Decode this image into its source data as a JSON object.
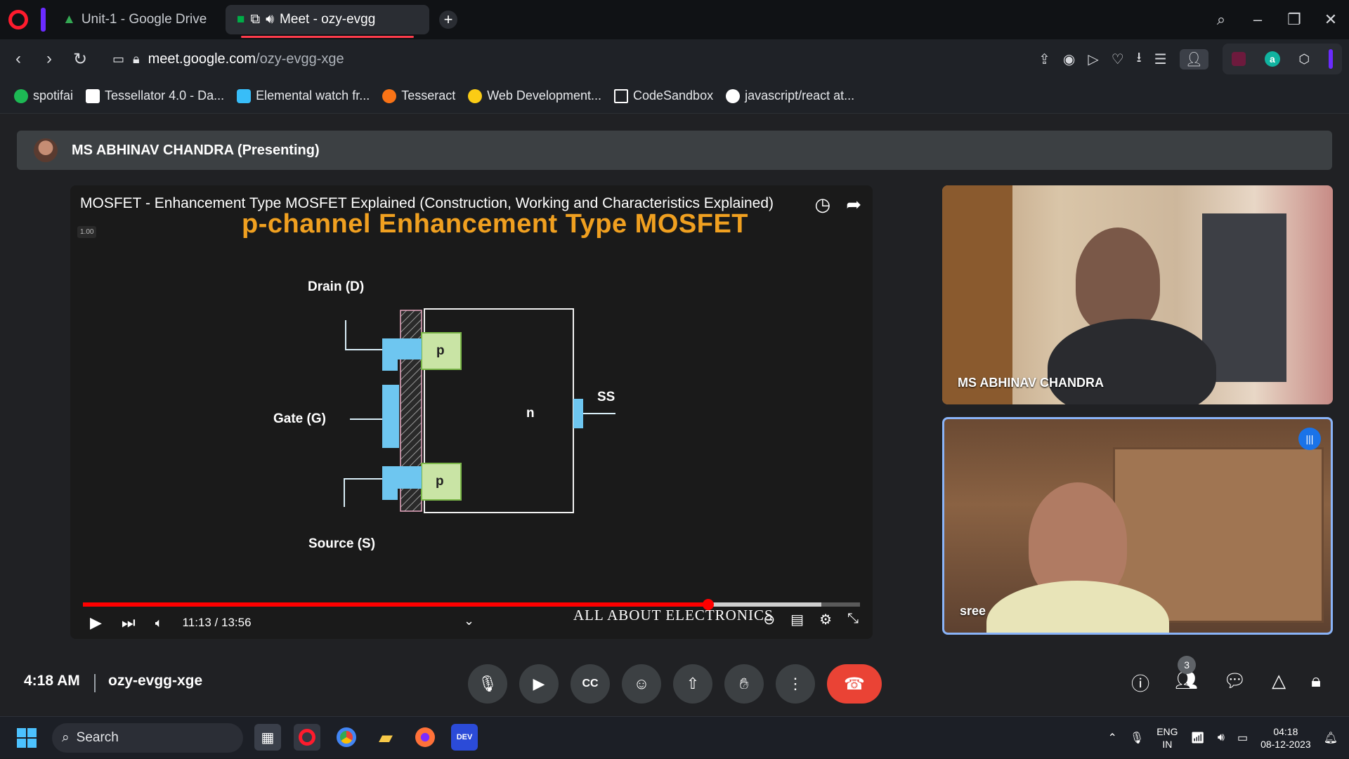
{
  "browser": {
    "tabs": [
      {
        "label": "Unit-1 - Google Drive",
        "active": false
      },
      {
        "label": "Meet - ozy-evgg",
        "active": true
      }
    ],
    "url_host": "meet.google.com",
    "url_path": "/ozy-evgg-xge",
    "bookmarks": [
      {
        "label": "spotifai",
        "color": "#1db954"
      },
      {
        "label": "Tessellator 4.0 - Da...",
        "color": "#ffffff"
      },
      {
        "label": "Elemental watch fr...",
        "color": "#38bdf8"
      },
      {
        "label": "Tesseract",
        "color": "#f97316"
      },
      {
        "label": "Web Development...",
        "color": "#facc15"
      },
      {
        "label": "CodeSandbox",
        "color": "#ffffff"
      },
      {
        "label": "javascript/react at...",
        "color": "#ffffff"
      }
    ]
  },
  "meet": {
    "presenter_label": "MS ABHINAV CHANDRA (Presenting)",
    "meeting_time": "4:18 AM",
    "meeting_code": "ozy-evgg-xge",
    "participant_count": "3",
    "tiles": [
      {
        "name": "MS ABHINAV CHANDRA",
        "speaking": false
      },
      {
        "name": "sree",
        "speaking": true
      }
    ]
  },
  "video": {
    "title": "MOSFET - Enhancement Type MOSFET Explained (Construction, Working and Characteristics Explained)",
    "speed_badge": "1.00",
    "heading": "p-channel Enhancement Type MOSFET",
    "labels": {
      "drain": "Drain (D)",
      "gate": "Gate (G)",
      "source": "Source (S)",
      "ss": "SS",
      "n": "n",
      "p_top": "p",
      "p_bottom": "p"
    },
    "time": "11:13 / 13:56",
    "progress_fraction": 0.8045,
    "buffered_fraction": 0.95,
    "watermark": "ALL ABOUT ELECTRONICS"
  },
  "taskbar": {
    "search_placeholder": "Search",
    "lang_top": "ENG",
    "lang_bottom": "IN",
    "clock_time": "04:18",
    "clock_date": "08-12-2023"
  }
}
